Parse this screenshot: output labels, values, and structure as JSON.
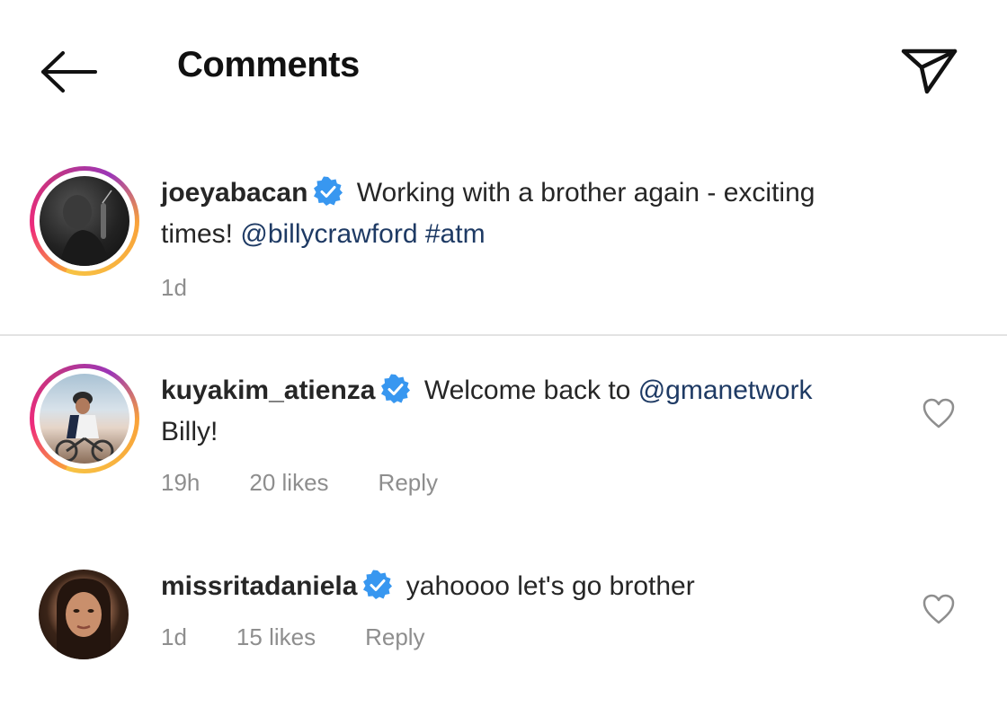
{
  "header": {
    "title": "Comments"
  },
  "caption": {
    "username": "joeyabacan",
    "verified": true,
    "text_line1": "Working with a brother again - exciting",
    "text_line2_prefix": "times! ",
    "mention": "@billycrawford",
    "hashtag": "#atm",
    "time": "1d"
  },
  "comments": [
    {
      "username": "kuyakim_atienza",
      "verified": true,
      "text_prefix": "Welcome back to ",
      "mention": "@gmanetwork",
      "text_line2": "Billy!",
      "time": "19h",
      "likes": "20 likes",
      "reply_label": "Reply"
    },
    {
      "username": "missritadaniela",
      "verified": true,
      "text": "yahoooo let's go brother",
      "time": "1d",
      "likes": "15 likes",
      "reply_label": "Reply"
    }
  ],
  "colors": {
    "mention": "#1e3a64",
    "verified": "#3897f0",
    "meta": "#8e8e8e",
    "divider": "#e3e3e3"
  }
}
